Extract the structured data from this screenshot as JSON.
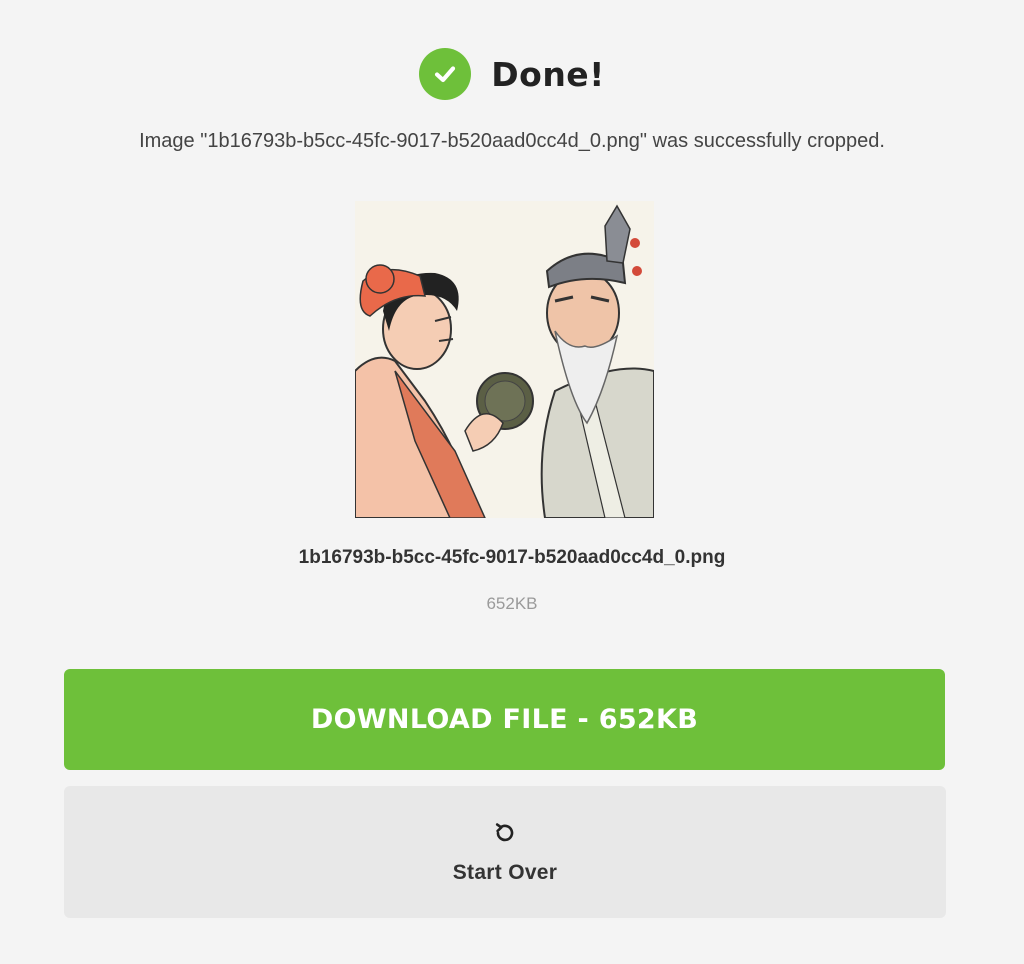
{
  "header": {
    "title": "Done!",
    "icon": "check-circle-icon",
    "accent_color": "#6ec03a"
  },
  "message": {
    "prefix": "Image \"",
    "file": "1b16793b-b5cc-45fc-9017-b520aad0cc4d_0.png",
    "suffix": "\" was successfully cropped."
  },
  "preview": {
    "alt": "Illustration of two men facing each other, one holding a round object"
  },
  "file": {
    "name": "1b16793b-b5cc-45fc-9017-b520aad0cc4d_0.png",
    "size": "652KB"
  },
  "actions": {
    "download_label": "DOWNLOAD FILE - 652KB",
    "start_over_label": "Start Over",
    "start_over_icon": "restart-icon"
  }
}
